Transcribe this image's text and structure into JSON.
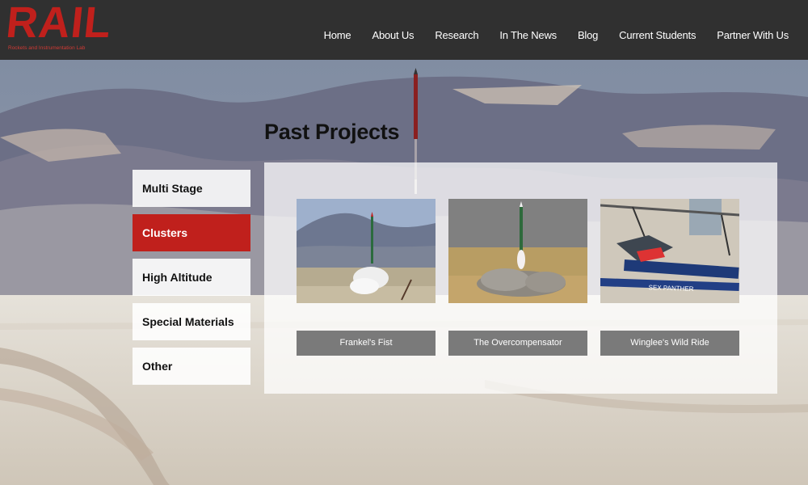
{
  "brand": {
    "logo_text": "RAIL",
    "logo_subtitle": "Rockets and Instrumentation Lab",
    "accent_color": "#c0201c"
  },
  "nav": {
    "items": [
      {
        "label": "Home"
      },
      {
        "label": "About Us"
      },
      {
        "label": "Research"
      },
      {
        "label": "In The News"
      },
      {
        "label": "Blog"
      },
      {
        "label": "Current Students"
      },
      {
        "label": "Partner With Us"
      }
    ]
  },
  "page": {
    "title": "Past Projects"
  },
  "sidebar": {
    "items": [
      {
        "label": "Multi Stage",
        "active": false
      },
      {
        "label": "Clusters",
        "active": true
      },
      {
        "label": "High Altitude",
        "active": false
      },
      {
        "label": "Special Materials",
        "active": false
      },
      {
        "label": "Other",
        "active": false
      }
    ]
  },
  "projects": [
    {
      "label": "Frankel's Fist",
      "image": "rocket-launch-mountains-photo"
    },
    {
      "label": "The Overcompensator",
      "image": "rocket-launch-desert-photo"
    },
    {
      "label": "Winglee's Wild Ride",
      "image": "rocket-on-ground-photo"
    }
  ]
}
